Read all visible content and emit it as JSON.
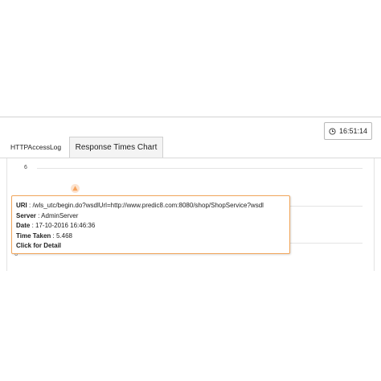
{
  "toolbar": {
    "clock_icon": "clock-icon",
    "clock_time": "16:51:14"
  },
  "tabs": [
    {
      "label": "HTTPAccessLog",
      "active": false
    },
    {
      "label": "Response Times Chart",
      "active": true
    }
  ],
  "chart": {
    "y_tick_top": "6",
    "y_axis_label_fragment": "ooo",
    "marker_color": "#f7a35c"
  },
  "tooltip": {
    "uri_label": "URI",
    "uri_value": "/wls_utc/begin.do?wsdlUrl=http://www.predic8.com:8080/shop/ShopService?wsdl",
    "server_label": "Server",
    "server_value": "AdminServer",
    "date_label": "Date",
    "date_value": "17-10-2016 16:46:36",
    "time_taken_label": "Time Taken",
    "time_taken_value": "5.468",
    "detail_link": "Click for Detail",
    "separator": " : "
  }
}
